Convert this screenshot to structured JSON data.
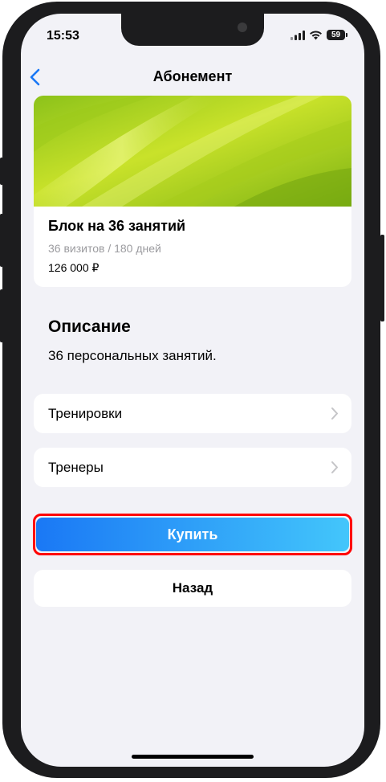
{
  "status_bar": {
    "time": "15:53",
    "battery": "59"
  },
  "nav": {
    "title": "Абонемент",
    "back_icon": "chevron-left-icon"
  },
  "membership": {
    "title": "Блок на 36 занятий",
    "subtitle": "36 визитов / 180 дней",
    "price": "126 000 ₽"
  },
  "description": {
    "heading": "Описание",
    "text": "36 персональных занятий."
  },
  "rows": [
    {
      "label": "Тренировки"
    },
    {
      "label": "Тренеры"
    }
  ],
  "actions": {
    "buy_label": "Купить",
    "back_label": "Назад"
  },
  "colors": {
    "accent": "#1a78f5",
    "accent_end": "#43c6fb",
    "highlight": "#ff0000",
    "background": "#f2f2f7"
  }
}
